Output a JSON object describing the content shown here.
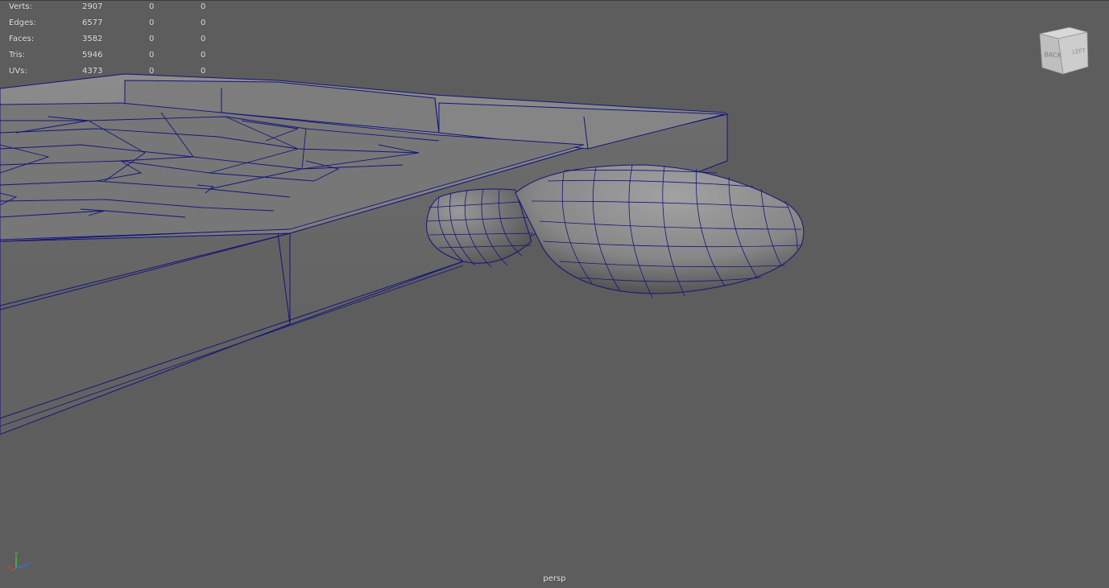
{
  "viewport": {
    "camera": "persp",
    "background": "#5d5d5d",
    "wire_color": "#14147a",
    "shade_color": "#8a8a8a"
  },
  "heads_up": {
    "rows": [
      {
        "label": "Verts:",
        "c1": "2907",
        "c2": "0",
        "c3": "0"
      },
      {
        "label": "Edges:",
        "c1": "6577",
        "c2": "0",
        "c3": "0"
      },
      {
        "label": "Faces:",
        "c1": "3582",
        "c2": "0",
        "c3": "0"
      },
      {
        "label": "Tris:",
        "c1": "5946",
        "c2": "0",
        "c3": "0"
      },
      {
        "label": "UVs:",
        "c1": "4373",
        "c2": "0",
        "c3": "0"
      }
    ]
  },
  "viewcube": {
    "front_face": "BACK",
    "side_face": "LEFT"
  },
  "axis": {
    "x": "x",
    "y": "y",
    "z": "z"
  }
}
